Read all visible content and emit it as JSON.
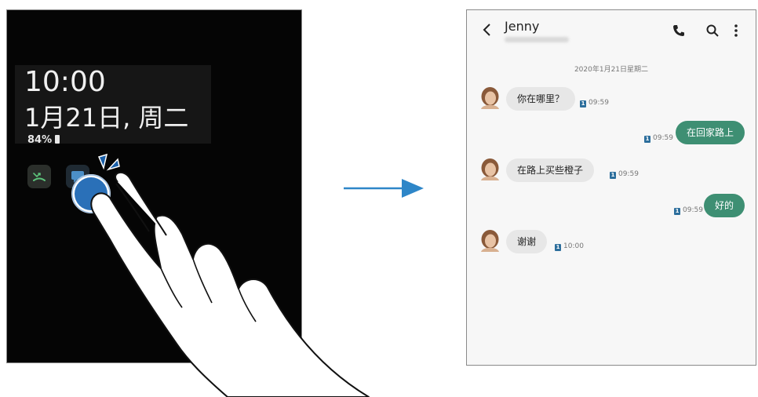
{
  "lock_screen": {
    "time": "10:00",
    "date": "1月21日, 周二",
    "battery": "84%"
  },
  "conversation": {
    "contact_name": "Jenny",
    "date_header": "2020年1月21日星期二",
    "sim_label": "1",
    "messages": [
      {
        "direction": "in",
        "text": "你在哪里？",
        "time": "09:59"
      },
      {
        "direction": "out",
        "text": "在回家路上",
        "time": "09:59"
      },
      {
        "direction": "in",
        "text": "在路上买些橙子",
        "time": "09:59"
      },
      {
        "direction": "out",
        "text": "好的",
        "time": "09:59"
      },
      {
        "direction": "in",
        "text": "谢谢",
        "time": "10:00"
      }
    ]
  },
  "colors": {
    "sent_bubble": "#3e8f73",
    "received_bubble": "#e7e7e7",
    "arrow": "#2e86c8",
    "touch_indicator": "#2a70b8"
  }
}
